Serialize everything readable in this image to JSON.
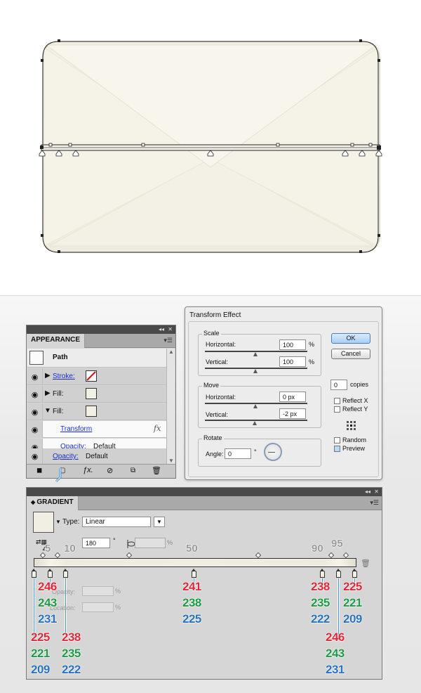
{
  "appearance": {
    "tab": "APPEARANCE",
    "title": "Path",
    "rows": [
      {
        "label": "Stroke:",
        "link": true
      },
      {
        "label": "Fill:",
        "link": false
      },
      {
        "label": "Fill:",
        "link": false
      }
    ],
    "transform": "Transform",
    "fx": "fx",
    "inner_opacity_label": "Opacity:",
    "inner_opacity_value": "Default",
    "opacity_label": "Opacity:",
    "opacity_value": "Default"
  },
  "transform_effect": {
    "title": "Transform Effect",
    "scale": {
      "label": "Scale",
      "horizontal_label": "Horizontal:",
      "horizontal": "100",
      "vertical_label": "Vertical:",
      "vertical": "100",
      "unit": "%"
    },
    "move": {
      "label": "Move",
      "horizontal_label": "Horizontal:",
      "horizontal": "0 px",
      "vertical_label": "Vertical:",
      "vertical": "-2 px"
    },
    "rotate": {
      "label": "Rotate",
      "angle_label": "Angle:",
      "angle": "0",
      "unit": "°"
    },
    "ok": "OK",
    "cancel": "Cancel",
    "copies": "0",
    "copies_label": "copies",
    "reflect_x": "Reflect X",
    "reflect_y": "Reflect Y",
    "random": "Random",
    "preview": "Preview"
  },
  "gradient": {
    "tab": "GRADIENT",
    "type_label": "Type:",
    "type": "Linear",
    "angle": "180",
    "degree": "°",
    "percent": "%",
    "opacity_label": "Opacity:",
    "location_label": "Location:",
    "locations": [
      "5",
      "10",
      "50",
      "90",
      "95"
    ],
    "labels": {
      "s0": {
        "r": "225",
        "g": "221",
        "b": "209"
      },
      "s1": {
        "r": "246",
        "g": "243",
        "b": "231"
      },
      "s2": {
        "r": "238",
        "g": "235",
        "b": "222"
      },
      "s3": {
        "r": "241",
        "g": "238",
        "b": "225"
      },
      "s4": {
        "r": "238",
        "g": "235",
        "b": "222"
      },
      "s5": {
        "r": "246",
        "g": "243",
        "b": "231"
      },
      "s6": {
        "r": "225",
        "g": "221",
        "b": "209"
      }
    }
  }
}
